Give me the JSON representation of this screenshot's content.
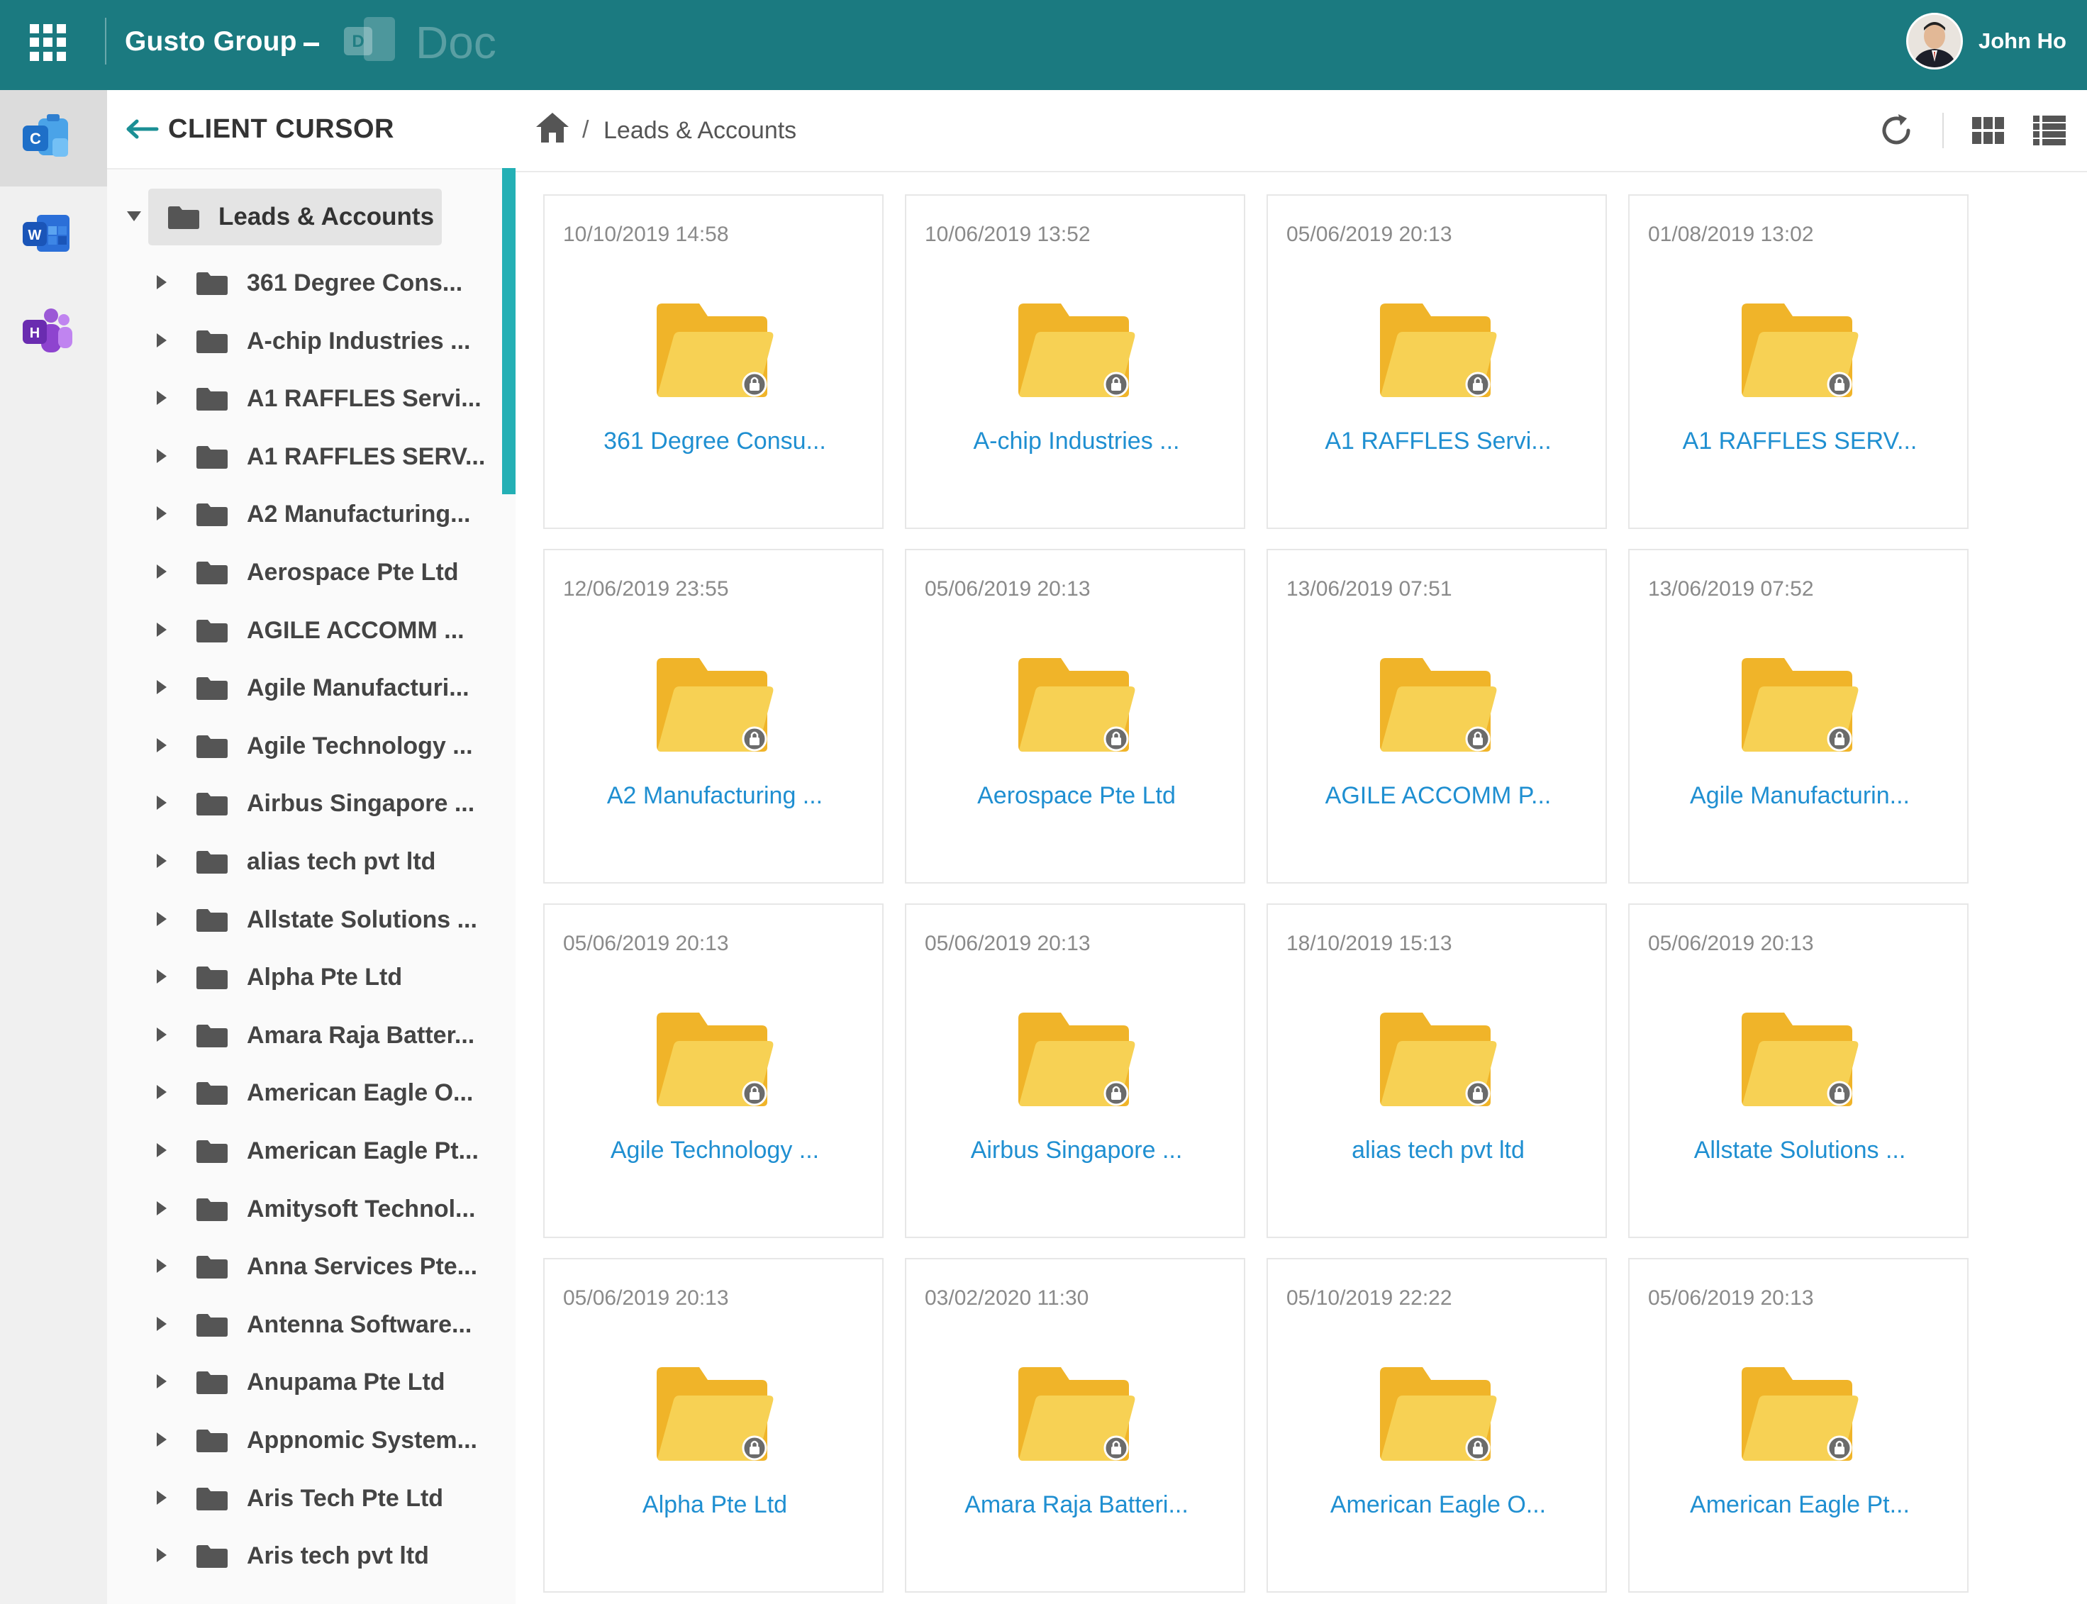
{
  "topbar": {
    "company": "Gusto Group",
    "app_name": "Doc",
    "user_name": "John Ho"
  },
  "rail": {
    "items": [
      {
        "icon": "client-cursor-app-icon",
        "letter": "C",
        "active": true
      },
      {
        "icon": "word-app-icon",
        "letter": "W",
        "active": false
      },
      {
        "icon": "hr-app-icon",
        "letter": "H",
        "active": false
      }
    ]
  },
  "tree": {
    "title": "CLIENT CURSOR",
    "root_label": "Leads & Accounts",
    "items": [
      "361 Degree Cons...",
      "A-chip Industries ...",
      "A1 RAFFLES Servi...",
      "A1 RAFFLES SERV...",
      "A2 Manufacturing...",
      "Aerospace Pte Ltd",
      "AGILE ACCOMM ...",
      "Agile Manufacturi...",
      "Agile Technology ...",
      "Airbus Singapore ...",
      "alias tech pvt ltd",
      "Allstate Solutions ...",
      "Alpha Pte Ltd",
      "Amara Raja Batter...",
      "American Eagle O...",
      "American Eagle Pt...",
      "Amitysoft Technol...",
      "Anna Services Pte...",
      "Antenna Software...",
      "Anupama Pte Ltd",
      "Appnomic System...",
      "Aris Tech Pte Ltd",
      "Aris tech pvt ltd"
    ]
  },
  "breadcrumb": {
    "separator": "/",
    "current": "Leads & Accounts"
  },
  "folders": [
    {
      "date": "10/10/2019 14:58",
      "name": "361 Degree Consu..."
    },
    {
      "date": "10/06/2019 13:52",
      "name": "A-chip Industries ..."
    },
    {
      "date": "05/06/2019 20:13",
      "name": "A1 RAFFLES Servi..."
    },
    {
      "date": "01/08/2019 13:02",
      "name": "A1 RAFFLES SERV..."
    },
    {
      "date": "12/06/2019 23:55",
      "name": "A2 Manufacturing ..."
    },
    {
      "date": "05/06/2019 20:13",
      "name": "Aerospace Pte Ltd"
    },
    {
      "date": "13/06/2019 07:51",
      "name": "AGILE ACCOMM P..."
    },
    {
      "date": "13/06/2019 07:52",
      "name": "Agile Manufacturin..."
    },
    {
      "date": "05/06/2019 20:13",
      "name": "Agile Technology ..."
    },
    {
      "date": "05/06/2019 20:13",
      "name": "Airbus Singapore ..."
    },
    {
      "date": "18/10/2019 15:13",
      "name": "alias tech pvt ltd"
    },
    {
      "date": "05/06/2019 20:13",
      "name": "Allstate Solutions ..."
    },
    {
      "date": "05/06/2019 20:13",
      "name": "Alpha Pte Ltd"
    },
    {
      "date": "03/02/2020 11:30",
      "name": "Amara Raja Batteri..."
    },
    {
      "date": "05/10/2019 22:22",
      "name": "American Eagle O..."
    },
    {
      "date": "05/06/2019 20:13",
      "name": "American Eagle Pt..."
    }
  ],
  "colors": {
    "topbar": "#1b7a80",
    "accent": "#24b0b5",
    "link": "#1f8fd1",
    "folder": "#f5c842"
  }
}
